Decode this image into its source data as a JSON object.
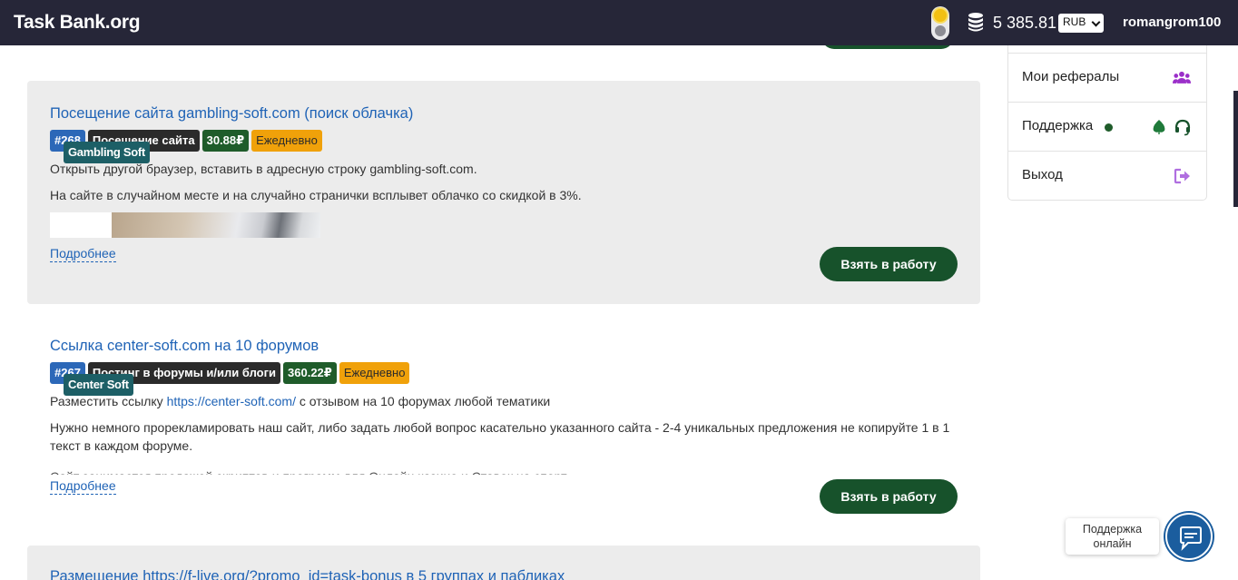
{
  "header": {
    "brand": "Task Bank.org",
    "balance": "5 385.81",
    "currency": "RUB",
    "username": "romangrom100"
  },
  "tasks": [
    {
      "title": "Посещение сайта gambling-soft.com (поиск облачка)",
      "id": "#268",
      "type": "Посещение сайта",
      "price": "30.88₽",
      "frequency": "Ежедневно",
      "brand": "Gambling Soft",
      "line1": "Открыть другой браузер, вставить в адресную строку gambling-soft.com.",
      "line2": "На сайте в случайном месте и на случайно странички всплывет облачко со скидкой в 3%.",
      "more": "Подробнее",
      "action": "Взять в работу"
    },
    {
      "title": "Ссылка center-soft.com на 10 форумов",
      "id": "#267",
      "type": "Постинг в форумы и/или блоги",
      "price": "360.22₽",
      "frequency": "Ежедневно",
      "brand": "Center Soft",
      "line1_prefix": "Разместить ссылку ",
      "line1_link": "https://center-soft.com/",
      "line1_suffix": " с отзывом на 10 форумах любой тематики",
      "line2": "Нужно немного прорекламировать наш сайт, либо задать любой вопрос касательно указанного сайта - 2-4 уникальных предложения не копируйте 1 в 1 текст в каждом форуме.",
      "line3_partial": "Сайт занимается продажей скриптов и программ для Онлайн казино и Ставок на спорт",
      "more": "Подробнее",
      "action": "Взять в работу"
    },
    {
      "title": "Размещение https://f-live.org/?promo_id=task-bonus в 5 группах и пабликах"
    }
  ],
  "sidebar": {
    "items": [
      {
        "label": "Мои рефералы",
        "icon": "users-icon"
      },
      {
        "label": "Поддержка",
        "icon": "headset-icon"
      },
      {
        "label": "Выход",
        "icon": "logout-icon"
      }
    ]
  },
  "chat": {
    "label": "Поддержка онлайн"
  },
  "colors": {
    "header_bg": "#262638",
    "accent_green": "#17522b",
    "link_blue": "#1f63b6",
    "tag_orange": "#f0a10a",
    "icon_purple": "#9b2fc9"
  }
}
